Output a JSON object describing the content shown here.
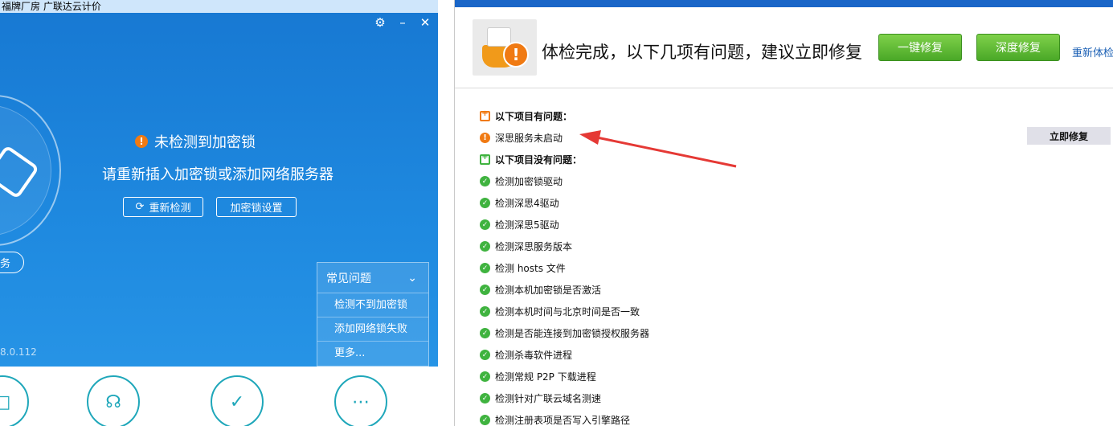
{
  "left": {
    "title_bar": "福牌厂房 广联达云计价",
    "status": "未检测到加密锁",
    "status_sub": "请重新插入加密锁或添加网络服务器",
    "redetect_label": "重新检测",
    "lock_settings_label": "加密锁设置",
    "service_pill_label": "务",
    "version": "8.0.112",
    "faq": {
      "header": "常见问题",
      "items": [
        "检测不到加密锁",
        "添加网络锁失败",
        "更多..."
      ]
    }
  },
  "right": {
    "header_title": "体检完成，以下几项有问题，建议立即修复",
    "quick_fix": "一键修复",
    "deep_fix": "深度修复",
    "recheck": "重新体检",
    "problems_title": "以下项目有问题：",
    "problem_item": "深思服务未启动",
    "fix_now": "立即修复",
    "ok_title": "以下项目没有问题：",
    "ok_items": [
      "检测加密锁驱动",
      "检测深思4驱动",
      "检测深思5驱动",
      "检测深思服务版本",
      "检测 hosts 文件",
      "检测本机加密锁是否激活",
      "检测本机时间与北京时间是否一致",
      "检测是否能连接到加密锁授权服务器",
      "检测杀毒软件进程",
      "检测常规 P2P 下载进程",
      "检测针对广联云域名测速",
      "检测注册表项是否写入引擎路径"
    ]
  },
  "colors": {
    "accent_blue": "#1f8ae0",
    "warn_orange": "#f07a13",
    "ok_green": "#3fb33f",
    "arrow_red": "#e53935"
  }
}
